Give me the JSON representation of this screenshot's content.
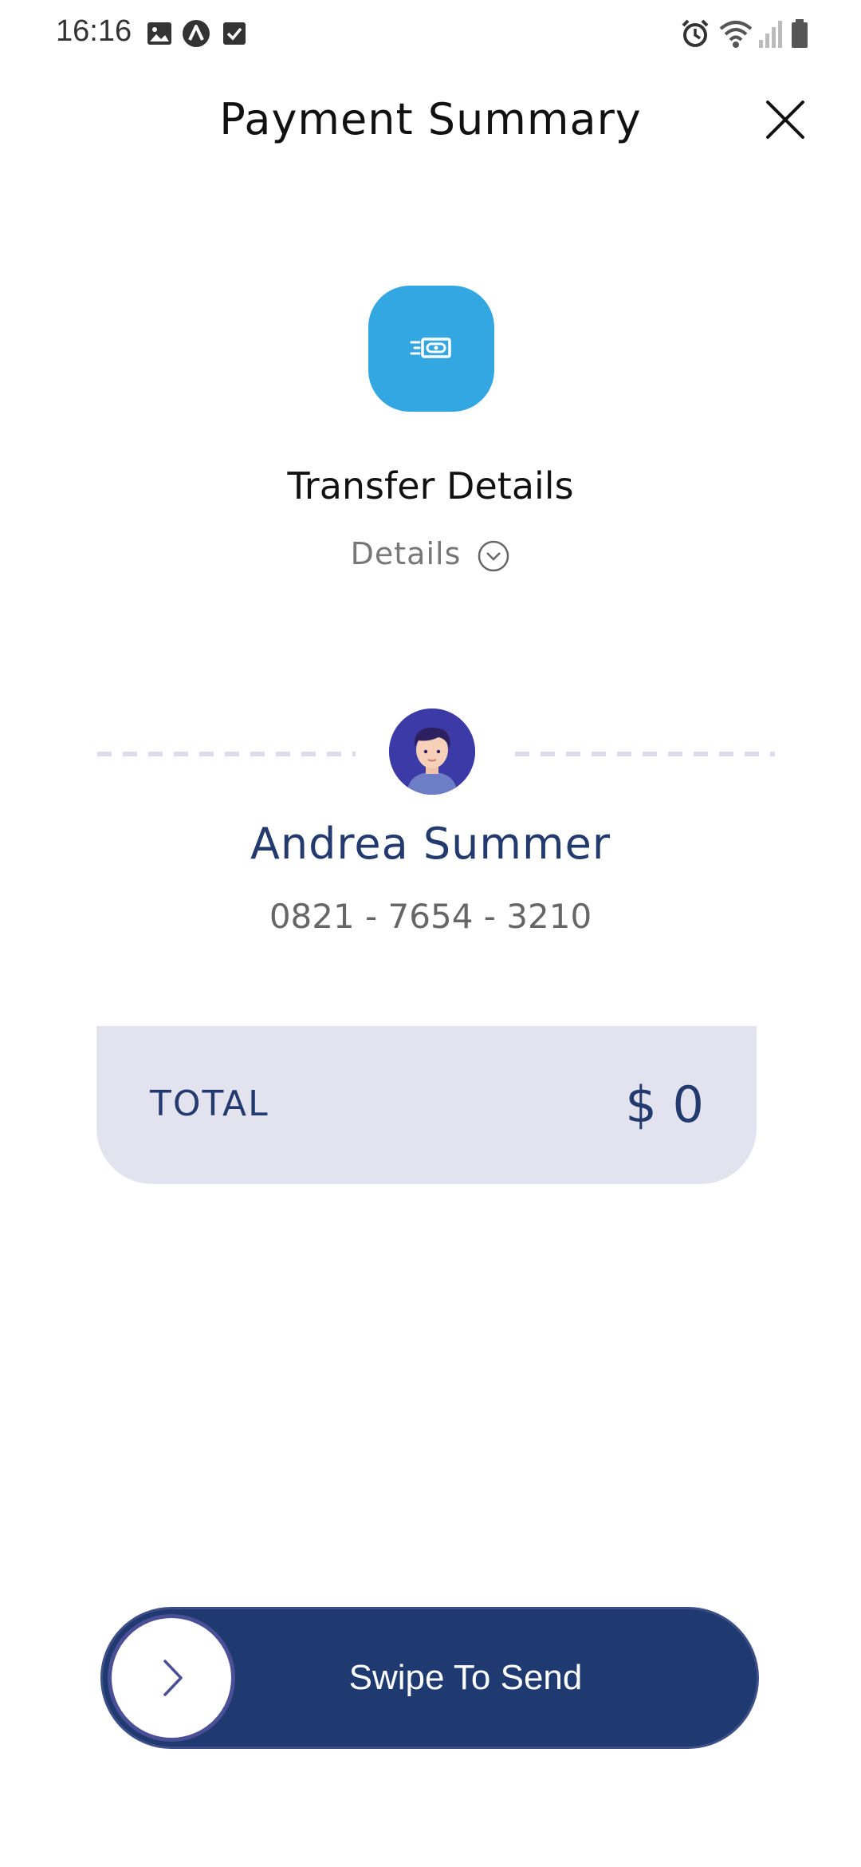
{
  "status_bar": {
    "time": "16:16",
    "left_icons": [
      "gallery-icon",
      "app-a-icon",
      "checkbox-icon"
    ],
    "right_icons": [
      "alarm-icon",
      "wifi-icon",
      "signal-icon",
      "battery-icon"
    ]
  },
  "header": {
    "title": "Payment Summary",
    "close_icon": "close-icon"
  },
  "transfer": {
    "icon": "money-transfer-icon",
    "icon_color": "#33a7e2",
    "title": "Transfer Details",
    "details_label": "Details",
    "details_icon": "chevron-down-circle-icon"
  },
  "recipient": {
    "name": "Andrea Summer",
    "phone": "0821 - 7654 - 3210"
  },
  "total": {
    "label": "TOTAL",
    "value": "$ 0"
  },
  "swipe": {
    "label": "Swipe To Send",
    "knob_icon": "chevron-right-icon",
    "color": "#1f3a70"
  }
}
